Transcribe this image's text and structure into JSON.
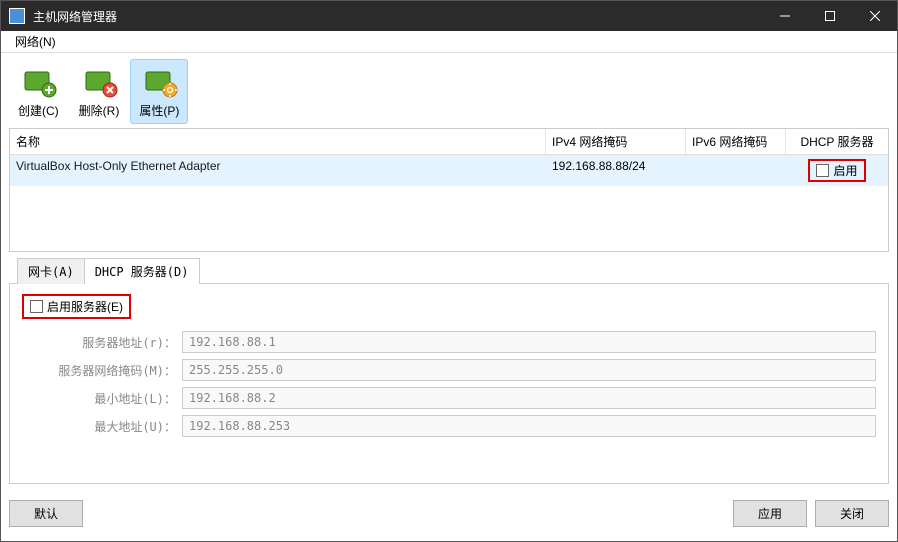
{
  "window": {
    "title": "主机网络管理器"
  },
  "menubar": {
    "network": "网络(N)"
  },
  "toolbar": {
    "create": "创建(C)",
    "delete": "删除(R)",
    "properties": "属性(P)"
  },
  "table": {
    "headers": {
      "name": "名称",
      "ipv4": "IPv4 网络掩码",
      "ipv6": "IPv6 网络掩码",
      "dhcp": "DHCP 服务器"
    },
    "rows": [
      {
        "name": "VirtualBox Host-Only Ethernet Adapter",
        "ipv4": "192.168.88.88/24",
        "ipv6": "",
        "dhcp_enable_label": "启用"
      }
    ]
  },
  "tabs": {
    "adapter": "网卡(A)",
    "dhcp": "DHCP 服务器(D)"
  },
  "dhcp_form": {
    "enable_label": "启用服务器(E)",
    "server_address_label": "服务器地址(r)：",
    "server_address": "192.168.88.1",
    "server_mask_label": "服务器网络掩码(M)：",
    "server_mask": "255.255.255.0",
    "lower_bound_label": "最小地址(L)：",
    "lower_bound": "192.168.88.2",
    "upper_bound_label": "最大地址(U)：",
    "upper_bound": "192.168.88.253"
  },
  "footer": {
    "default": "默认",
    "apply": "应用",
    "close": "关闭"
  }
}
